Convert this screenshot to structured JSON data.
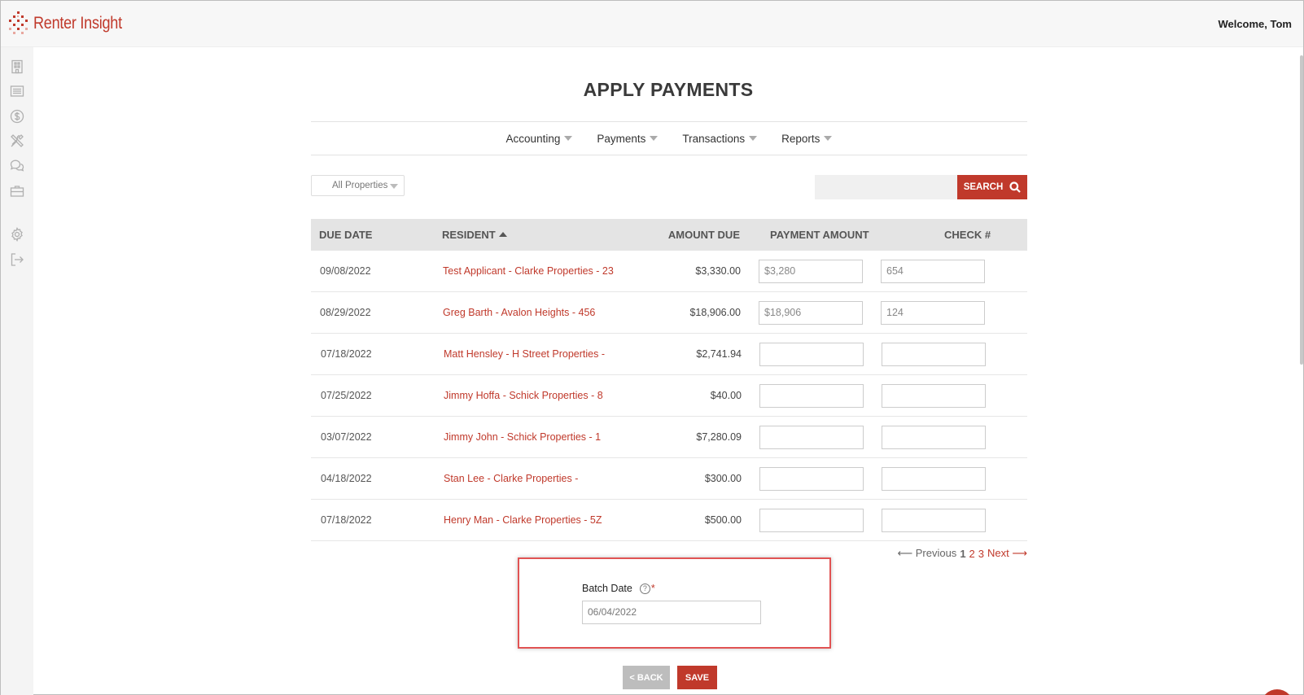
{
  "app": {
    "name": "Renter Insight",
    "welcome": "Welcome, Tom"
  },
  "sidebar": {
    "icons": [
      "building-icon",
      "list-icon",
      "dollar-icon",
      "tools-icon",
      "chat-icon",
      "briefcase-icon",
      "gear-icon",
      "logout-icon"
    ]
  },
  "page": {
    "title": "APPLY PAYMENTS"
  },
  "subnav": [
    {
      "label": "Accounting"
    },
    {
      "label": "Payments"
    },
    {
      "label": "Transactions"
    },
    {
      "label": "Reports"
    }
  ],
  "filters": {
    "property_select": "All Properties",
    "search_placeholder": "",
    "search_label": "SEARCH"
  },
  "table": {
    "headers": {
      "due_date": "DUE DATE",
      "resident": "RESIDENT",
      "amount_due": "AMOUNT DUE",
      "payment_amount": "PAYMENT AMOUNT",
      "check": "CHECK #"
    },
    "rows": [
      {
        "date": "09/08/2022",
        "resident": "Test Applicant - Clarke Properties - 23",
        "amount": "$3,330.00",
        "payment": "$3,280",
        "check": "654"
      },
      {
        "date": "08/29/2022",
        "resident": "Greg Barth - Avalon Heights - 456",
        "amount": "$18,906.00",
        "payment": "$18,906",
        "check": "124"
      },
      {
        "date": "07/18/2022",
        "resident": "Matt Hensley - H Street Properties -",
        "amount": "$2,741.94",
        "payment": "",
        "check": ""
      },
      {
        "date": "07/25/2022",
        "resident": "Jimmy Hoffa - Schick Properties - 8",
        "amount": "$40.00",
        "payment": "",
        "check": ""
      },
      {
        "date": "03/07/2022",
        "resident": "Jimmy John - Schick Properties - 1",
        "amount": "$7,280.09",
        "payment": "",
        "check": ""
      },
      {
        "date": "04/18/2022",
        "resident": "Stan Lee - Clarke Properties -",
        "amount": "$300.00",
        "payment": "",
        "check": ""
      },
      {
        "date": "07/18/2022",
        "resident": "Henry Man - Clarke Properties - 5Z",
        "amount": "$500.00",
        "payment": "",
        "check": ""
      }
    ]
  },
  "pagination": {
    "previous": "⟵ Previous",
    "pages": [
      "1",
      "2",
      "3"
    ],
    "next": "Next ⟶"
  },
  "batch": {
    "label": "Batch Date",
    "help": "?",
    "required": "*",
    "value": "06/04/2022"
  },
  "actions": {
    "back": "< BACK",
    "save": "SAVE"
  },
  "colors": {
    "brand": "#c0392b",
    "header_bg": "#e4e4e4",
    "back": "#bdbdbd"
  }
}
